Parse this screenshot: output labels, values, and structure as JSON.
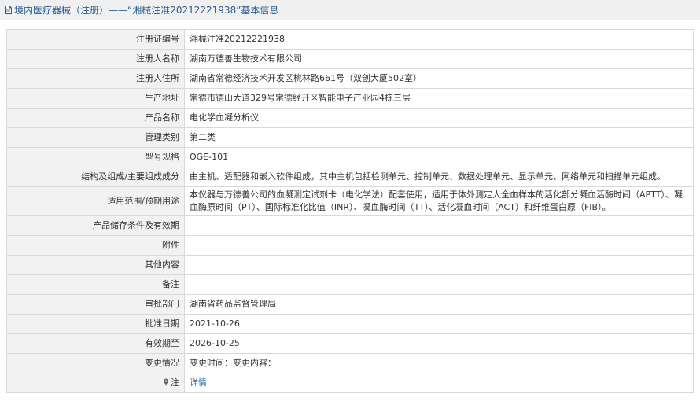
{
  "header": {
    "title": "境内医疗器械（注册）——“湘械注准20212221938”基本信息"
  },
  "rows": [
    {
      "label": "注册证编号",
      "value": "湘械注准20212221938"
    },
    {
      "label": "注册人名称",
      "value": "湖南万德善生物技术有限公司"
    },
    {
      "label": "注册人住所",
      "value": "湖南省常德经济技术开发区桃林路661号（双创大厦502室）"
    },
    {
      "label": "生产地址",
      "value": "常德市德山大道329号常德经开区智能电子产业园4栋三层"
    },
    {
      "label": "产品名称",
      "value": "电化学血凝分析仪"
    },
    {
      "label": "管理类别",
      "value": "第二类"
    },
    {
      "label": "型号规格",
      "value": "OGE-101"
    },
    {
      "label": "结构及组成/主要组成成分",
      "value": "由主机、适配器和嵌入软件组成，其中主机包括检测单元、控制单元、数据处理单元、显示单元、网络单元和扫描单元组成。"
    },
    {
      "label": "适用范围/预期用途",
      "value": "本仪器与万德善公司的血凝测定试剂卡（电化学法）配套使用，适用于体外测定人全血样本的活化部分凝血活酶时间（APTT）、凝血酶原时间（PT）、国际标准化比值（INR）、凝血酶时间（TT）、活化凝血时间（ACT）和纤维蛋白原（FIB）。"
    },
    {
      "label": "产品储存条件及有效期",
      "value": ""
    },
    {
      "label": "附件",
      "value": ""
    },
    {
      "label": "其他内容",
      "value": ""
    },
    {
      "label": "备注",
      "value": ""
    },
    {
      "label": "审批部门",
      "value": "湖南省药品监督管理局"
    },
    {
      "label": "批准日期",
      "value": "2021-10-26"
    },
    {
      "label": "有效期至",
      "value": "2026-10-25"
    },
    {
      "label": "变更情况",
      "value": "变更时间：变更内容："
    },
    {
      "label": "注",
      "value": "详情"
    }
  ],
  "icons": {
    "header": "document-icon",
    "note": "pin-icon"
  },
  "colors": {
    "header_text": "#2a5c8f",
    "link": "#2f6fb3",
    "label_bg": "#f2f2f2",
    "border": "#d9d9d9"
  }
}
